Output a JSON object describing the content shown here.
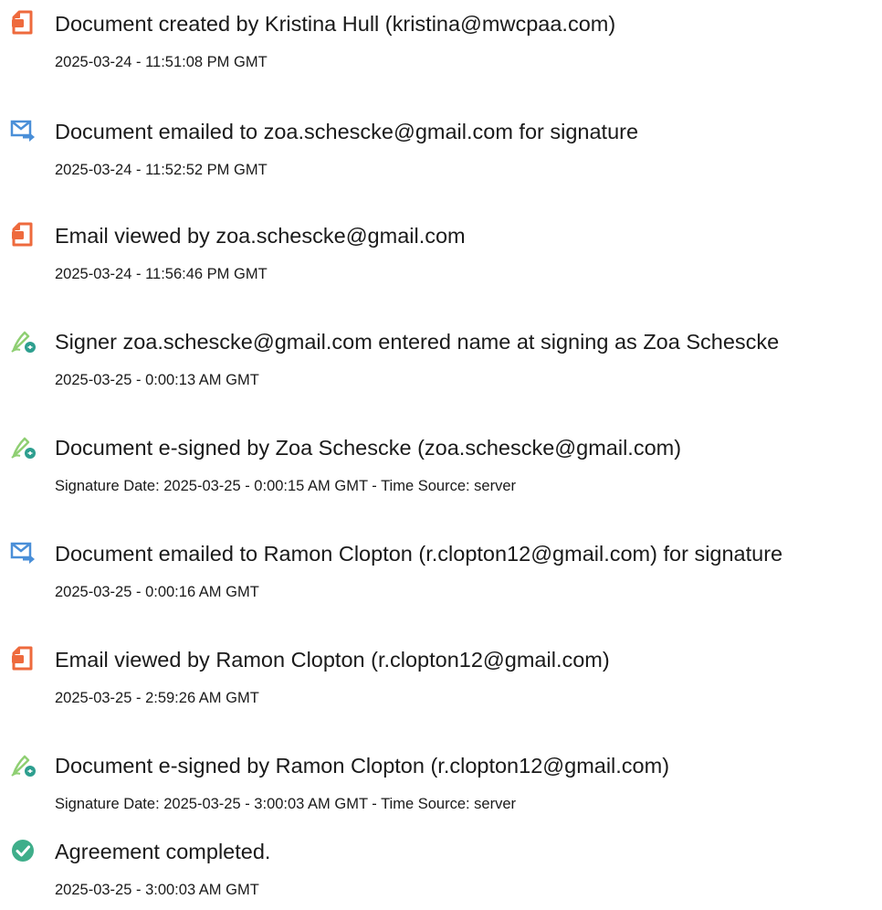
{
  "events": [
    {
      "icon": "document-created-icon",
      "title": "Document created by Kristina Hull (kristina@mwcpaa.com)",
      "time": "2025-03-24 - 11:51:08 PM GMT"
    },
    {
      "icon": "email-sent-icon",
      "title": "Document emailed to zoa.schescke@gmail.com for signature",
      "time": "2025-03-24 - 11:52:52 PM GMT"
    },
    {
      "icon": "document-viewed-icon",
      "title": "Email viewed by zoa.schescke@gmail.com",
      "time": "2025-03-24 - 11:56:46 PM GMT"
    },
    {
      "icon": "e-sign-pen-icon",
      "title": "Signer zoa.schescke@gmail.com entered name at signing as Zoa Schescke",
      "time": "2025-03-25 - 0:00:13 AM GMT"
    },
    {
      "icon": "e-sign-pen-icon",
      "title": "Document e-signed by Zoa Schescke (zoa.schescke@gmail.com)",
      "time": "Signature Date: 2025-03-25 - 0:00:15 AM GMT - Time Source: server"
    },
    {
      "icon": "email-sent-icon",
      "title": "Document emailed to Ramon Clopton (r.clopton12@gmail.com) for signature",
      "time": "2025-03-25 - 0:00:16 AM GMT"
    },
    {
      "icon": "document-viewed-icon",
      "title": "Email viewed by Ramon Clopton (r.clopton12@gmail.com)",
      "time": "2025-03-25 - 2:59:26 AM GMT"
    },
    {
      "icon": "e-sign-pen-icon",
      "title": "Document e-signed by Ramon Clopton (r.clopton12@gmail.com)",
      "time": "Signature Date: 2025-03-25 - 3:00:03 AM GMT - Time Source: server"
    },
    {
      "icon": "checkmark-circle-icon",
      "title": "Agreement completed.",
      "time": "2025-03-25 - 3:00:03 AM GMT"
    }
  ],
  "colors": {
    "document_icon": "#ee6a3d",
    "email_icon": "#4a8fd8",
    "esign_icon": "#8fcf73",
    "esign_badge": "#2e9f8f",
    "complete_icon": "#3fae8a"
  }
}
